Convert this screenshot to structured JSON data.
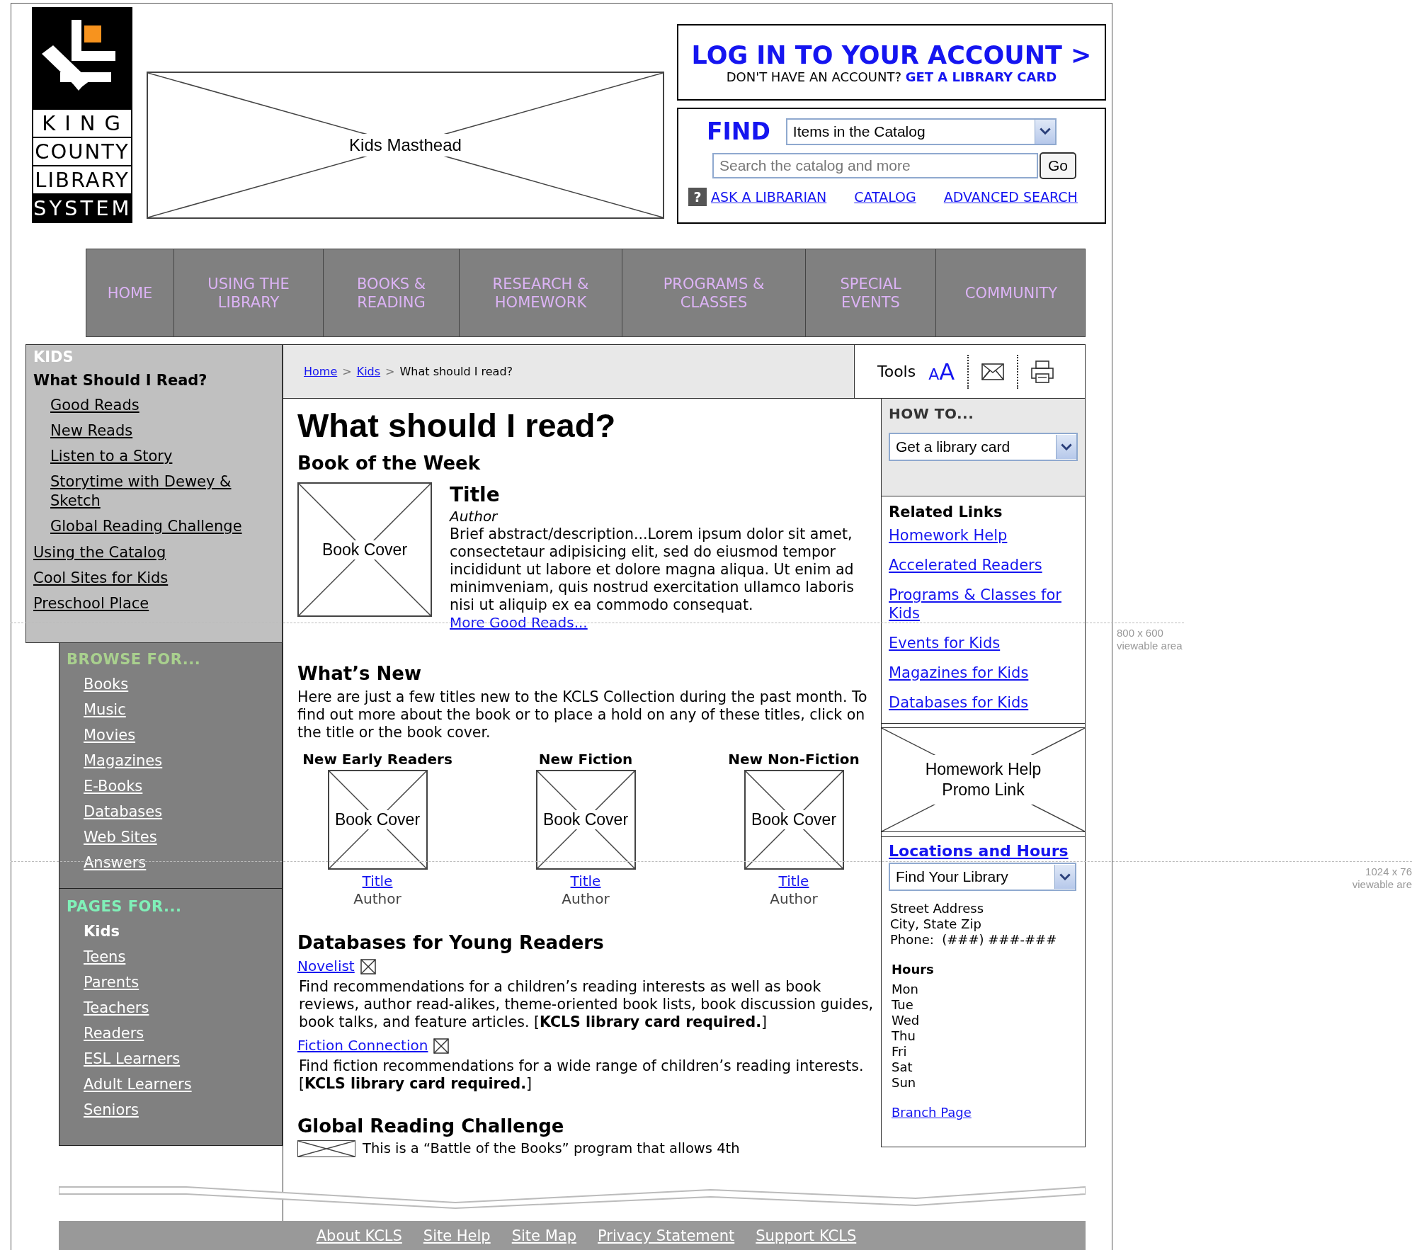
{
  "logo": {
    "lines": [
      "KING",
      "COUNTY",
      "LIBRARY",
      "SYSTEM"
    ]
  },
  "masthead": {
    "label": "Kids Masthead"
  },
  "account": {
    "login": "LOG IN TO YOUR ACCOUNT >",
    "prompt": "DON'T HAVE AN ACCOUNT?",
    "card_link": "GET A LIBRARY CARD"
  },
  "find": {
    "label": "FIND",
    "scope": "Items in the Catalog",
    "placeholder": "Search the catalog and more",
    "go": "Go",
    "help_icon": "?",
    "links": [
      "ASK A LIBRARIAN",
      "CATALOG",
      "ADVANCED SEARCH"
    ]
  },
  "nav": [
    {
      "label": "HOME"
    },
    {
      "label": "USING THE LIBRARY"
    },
    {
      "label": "BOOKS & READING"
    },
    {
      "label": "RESEARCH & HOMEWORK"
    },
    {
      "label": "PROGRAMS & CLASSES"
    },
    {
      "label": "SPECIAL EVENTS"
    },
    {
      "label": "COMMUNITY"
    }
  ],
  "sidebar": {
    "section": "KIDS",
    "items": [
      {
        "label": "What Should I Read?",
        "selected": true,
        "children": [
          {
            "label": "Good Reads"
          },
          {
            "label": "New Reads"
          },
          {
            "label": "Listen to a Story"
          },
          {
            "label": "Storytime with Dewey & Sketch"
          },
          {
            "label": "Global Reading Challenge"
          }
        ]
      },
      {
        "label": "Using the Catalog",
        "selected": false
      },
      {
        "label": "Cool Sites for Kids",
        "selected": false
      },
      {
        "label": "Preschool Place",
        "selected": false
      }
    ]
  },
  "browse": {
    "heading": "BROWSE FOR...",
    "items": [
      "Books",
      "Music",
      "Movies",
      "Magazines",
      "E-Books",
      "Databases",
      "Web Sites",
      "Answers"
    ]
  },
  "pages_for": {
    "heading": "PAGES FOR...",
    "items": [
      {
        "label": "Kids",
        "selected": true
      },
      {
        "label": "Teens",
        "selected": false
      },
      {
        "label": "Parents",
        "selected": false
      },
      {
        "label": "Teachers",
        "selected": false
      },
      {
        "label": "Readers",
        "selected": false
      },
      {
        "label": "ESL Learners",
        "selected": false
      },
      {
        "label": "Adult Learners",
        "selected": false
      },
      {
        "label": "Seniors",
        "selected": false
      }
    ]
  },
  "breadcrumb": [
    {
      "label": "Home",
      "kind": "link"
    },
    {
      "separator": ">",
      "label": "Kids",
      "kind": "link"
    },
    {
      "separator": ">",
      "label": "What should I read?",
      "kind": "current"
    }
  ],
  "tools": {
    "label": "Tools",
    "text_size": {
      "small": "A",
      "large": "A"
    }
  },
  "main": {
    "title": "What should I read?",
    "book_of_week": {
      "heading": "Book of the Week",
      "cover": "Book Cover",
      "title": "Title",
      "author": "Author",
      "description": "Brief abstract/description...Lorem ipsum dolor sit amet, consectetaur adipisicing elit, sed do eiusmod tempor incididunt ut labore et dolore magna aliqua. Ut enim ad minimveniam, quis nostrud exercitation ullamco laboris nisi ut aliquip ex ea commodo consequat.",
      "more": "More Good Reads..."
    },
    "whats_new": {
      "heading": "What’s New",
      "intro": "Here are just a few titles new to the KCLS Collection during the past month. To find out more about the book or to place a hold on any of these titles, click on the title or the book cover.",
      "columns": [
        {
          "heading": "New Early Readers",
          "cover": "Book Cover",
          "title": "Title",
          "author": "Author"
        },
        {
          "heading": "New Fiction",
          "cover": "Book Cover",
          "title": "Title",
          "author": "Author"
        },
        {
          "heading": "New Non-Fiction",
          "cover": "Book Cover",
          "title": "Title",
          "author": "Author"
        }
      ]
    },
    "databases": {
      "heading": "Databases for Young Readers",
      "items": [
        {
          "link": "Novelist",
          "description": "Find recommendations for a children’s reading interests as well as book reviews, author read-alikes, theme-oriented book lists, book discussion guides, book talks, and feature articles. [**KCLS library card required.**]"
        },
        {
          "link": "Fiction Connection",
          "description": "Find fiction recommendations for a wide range of children’s reading interests. [**KCLS library card required.**]"
        }
      ]
    },
    "global": {
      "heading": "Global Reading Challenge",
      "text": "This is a “Battle of the Books” program that allows 4th"
    }
  },
  "how_to": {
    "heading": "HOW TO...",
    "select": "Get a library card"
  },
  "related": {
    "heading": "Related Links",
    "links": [
      "Homework Help",
      "Accelerated Readers",
      "Programs & Classes for Kids",
      "Events for Kids",
      "Magazines for Kids",
      "Databases for Kids"
    ]
  },
  "promo": {
    "label": "Homework Help Promo Link"
  },
  "locations": {
    "heading": "Locations and Hours",
    "select": "Find Your Library",
    "address": [
      "Street Address",
      "City, State Zip",
      "Phone:  (###) ###-###"
    ],
    "hours_heading": "Hours",
    "days": [
      "Mon",
      "Tue",
      "Wed",
      "Thu",
      "Fri",
      "Sat",
      "Sun"
    ],
    "branch_link": "Branch Page"
  },
  "footer": [
    "About KCLS",
    "Site Help",
    "Site Map",
    "Privacy Statement",
    "Support KCLS"
  ],
  "guides": [
    {
      "lines": [
        "800 x 600",
        "viewable area"
      ]
    },
    {
      "lines": [
        "1024 x 76",
        "viewable are"
      ]
    }
  ]
}
